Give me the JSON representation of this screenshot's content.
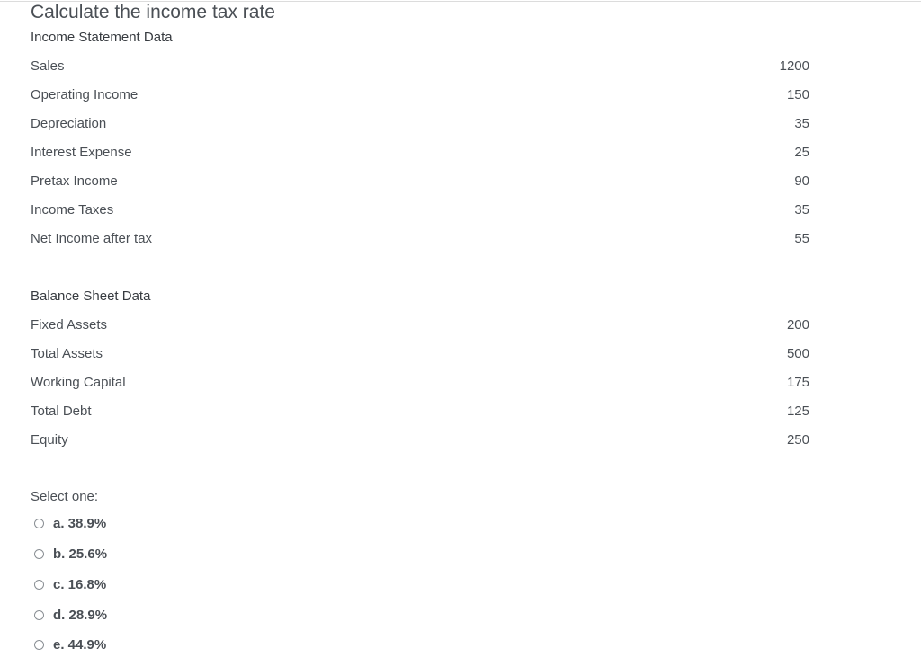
{
  "question": {
    "title": "Calculate the income tax rate"
  },
  "income_statement": {
    "heading": "Income Statement Data",
    "rows": [
      {
        "label": "Sales",
        "value": "1200"
      },
      {
        "label": "Operating Income",
        "value": "150"
      },
      {
        "label": "Depreciation",
        "value": "35"
      },
      {
        "label": "Interest Expense",
        "value": "25"
      },
      {
        "label": "Pretax Income",
        "value": "90"
      },
      {
        "label": "Income Taxes",
        "value": "35"
      },
      {
        "label": "Net Income after tax",
        "value": "55"
      }
    ]
  },
  "balance_sheet": {
    "heading": "Balance Sheet Data",
    "rows": [
      {
        "label": "Fixed Assets",
        "value": "200"
      },
      {
        "label": "Total Assets",
        "value": "500"
      },
      {
        "label": "Working Capital",
        "value": "175"
      },
      {
        "label": "Total Debt",
        "value": "125"
      },
      {
        "label": "Equity",
        "value": "250"
      }
    ]
  },
  "answer": {
    "prompt": "Select one:",
    "options": [
      {
        "label": "a. 38.9%",
        "selected": false
      },
      {
        "label": "b. 25.6%",
        "selected": false
      },
      {
        "label": "c. 16.8%",
        "selected": false
      },
      {
        "label": "d. 28.9%",
        "selected": false
      },
      {
        "label": "e. 44.9%",
        "selected": false
      }
    ]
  }
}
